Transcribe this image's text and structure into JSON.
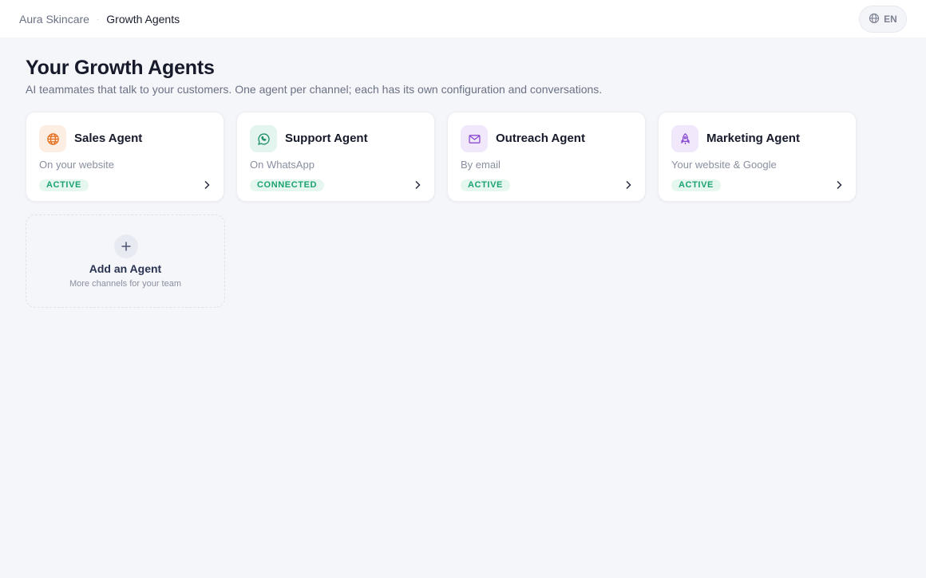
{
  "breadcrumb": {
    "root": "Aura Skincare",
    "separator": "·",
    "current": "Growth Agents"
  },
  "language": {
    "code": "EN",
    "icon": "globe-icon"
  },
  "header": {
    "title": "Your Growth Agents",
    "subtitle": "AI teammates that talk to your customers. One agent per channel; each has its own configuration and conversations."
  },
  "agents": [
    {
      "name": "Sales Agent",
      "channel": "On your website",
      "status": "ACTIVE",
      "icon": "globe-icon",
      "accent": "#e4701e",
      "icon_bg": "#fdeee3"
    },
    {
      "name": "Support Agent",
      "channel": "On WhatsApp",
      "status": "CONNECTED",
      "icon": "whatsapp-icon",
      "accent": "#1f8f66",
      "icon_bg": "#e3f5ee"
    },
    {
      "name": "Outreach Agent",
      "channel": "By email",
      "status": "ACTIVE",
      "icon": "mail-icon",
      "accent": "#8a4bd1",
      "icon_bg": "#f1e9fb"
    },
    {
      "name": "Marketing Agent",
      "channel": "Your website & Google",
      "status": "ACTIVE",
      "icon": "rocket-icon",
      "accent": "#8a4bd1",
      "icon_bg": "#f1e9fb"
    }
  ],
  "add_agent": {
    "title": "Add an Agent",
    "subtitle": "More channels for your team",
    "icon": "plus-icon"
  },
  "colors": {
    "status_text": "#1aa36f",
    "status_bg": "#e5f7ef",
    "page_bg": "#f5f6fa"
  }
}
